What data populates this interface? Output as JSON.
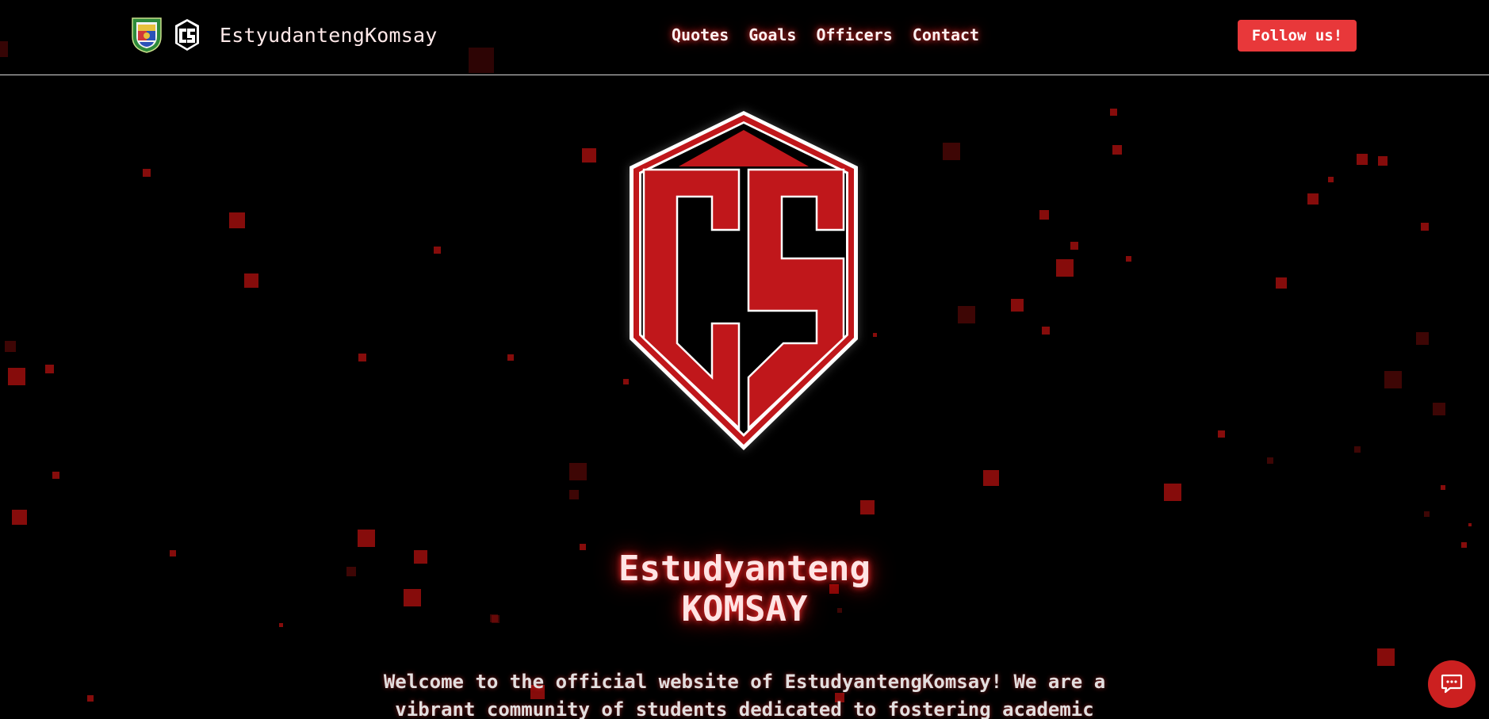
{
  "header": {
    "site_name": "EstyudantengKomsay",
    "nav": [
      {
        "label": "Quotes"
      },
      {
        "label": "Goals"
      },
      {
        "label": "Officers"
      },
      {
        "label": "Contact"
      }
    ],
    "follow_label": "Follow us!"
  },
  "icons": {
    "school_seal": "school-seal-logo",
    "cs_mini": "cs-shield-logo",
    "chat": "chat-bubble-icon"
  },
  "hero": {
    "title_line1": "Estudyanteng",
    "title_line2": "KOMSAY",
    "description": "Welcome to the official website of EstudyantengKomsay! We are a vibrant community of students dedicated to fostering academic"
  },
  "colors": {
    "accent_red": "#c0171b",
    "button_red": "#e8383a",
    "background": "#000000"
  }
}
